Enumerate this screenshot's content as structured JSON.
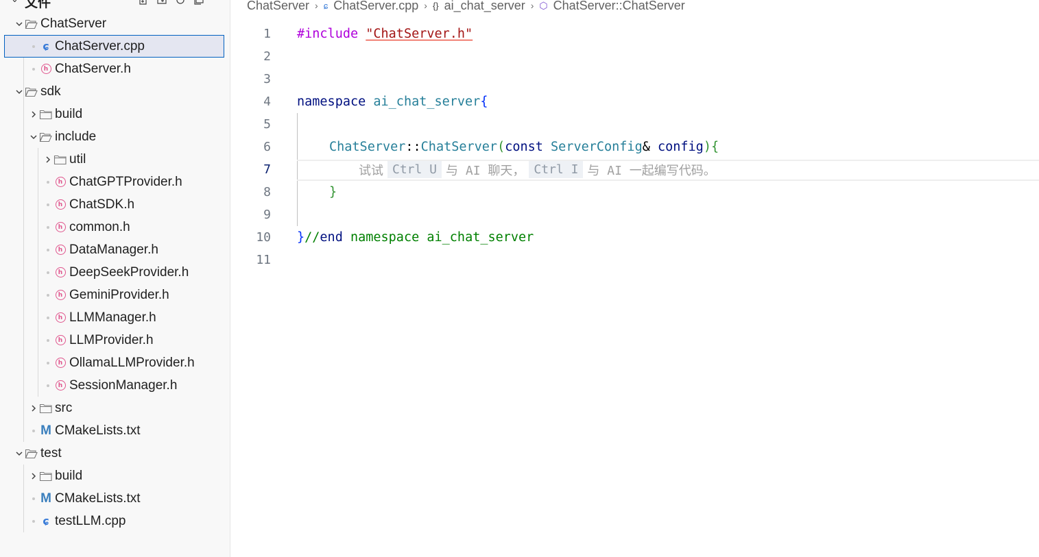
{
  "sidebar": {
    "title": "文件",
    "actions": [
      "new-file-icon",
      "new-folder-icon",
      "refresh-icon",
      "collapse-all-icon"
    ],
    "items": [
      {
        "label": "ChatServer",
        "type": "folder-open",
        "depth": 0
      },
      {
        "label": "ChatServer.cpp",
        "type": "cpp",
        "depth": 1,
        "selected": true
      },
      {
        "label": "ChatServer.h",
        "type": "h",
        "depth": 1
      },
      {
        "label": "sdk",
        "type": "folder-open",
        "depth": 0
      },
      {
        "label": "build",
        "type": "folder-closed",
        "depth": 1
      },
      {
        "label": "include",
        "type": "folder-open",
        "depth": 1
      },
      {
        "label": "util",
        "type": "folder-closed",
        "depth": 2
      },
      {
        "label": "ChatGPTProvider.h",
        "type": "h",
        "depth": 2
      },
      {
        "label": "ChatSDK.h",
        "type": "h",
        "depth": 2
      },
      {
        "label": "common.h",
        "type": "h",
        "depth": 2
      },
      {
        "label": "DataManager.h",
        "type": "h",
        "depth": 2
      },
      {
        "label": "DeepSeekProvider.h",
        "type": "h",
        "depth": 2
      },
      {
        "label": "GeminiProvider.h",
        "type": "h",
        "depth": 2
      },
      {
        "label": "LLMManager.h",
        "type": "h",
        "depth": 2
      },
      {
        "label": "LLMProvider.h",
        "type": "h",
        "depth": 2
      },
      {
        "label": "OllamaLLMProvider.h",
        "type": "h",
        "depth": 2
      },
      {
        "label": "SessionManager.h",
        "type": "h",
        "depth": 2
      },
      {
        "label": "src",
        "type": "folder-closed",
        "depth": 1
      },
      {
        "label": "CMakeLists.txt",
        "type": "cmake",
        "depth": 1
      },
      {
        "label": "test",
        "type": "folder-open",
        "depth": 0
      },
      {
        "label": "build",
        "type": "folder-closed",
        "depth": 1
      },
      {
        "label": "CMakeLists.txt",
        "type": "cmake",
        "depth": 1
      },
      {
        "label": "testLLM.cpp",
        "type": "cpp",
        "depth": 1
      }
    ]
  },
  "breadcrumb": {
    "items": [
      "ChatServer",
      "ChatServer.cpp",
      "ai_chat_server",
      "ChatServer::ChatServer"
    ]
  },
  "editor": {
    "active_line": 7,
    "line_numbers": [
      "1",
      "2",
      "3",
      "4",
      "5",
      "6",
      "7",
      "8",
      "9",
      "10",
      "11"
    ],
    "code": {
      "l1_directive": "#include",
      "l1_string": "\"ChatServer.h\"",
      "l4_keyword": "namespace",
      "l4_name": "ai_chat_server",
      "l4_brace": "{",
      "l6_class": "ChatServer",
      "l6_scope": "::",
      "l6_ctor": "ChatServer",
      "l6_paren_open": "(",
      "l6_const": "const",
      "l6_type": "ServerConfig",
      "l6_amp": "&",
      "l6_param": "config",
      "l6_paren_close": ")",
      "l6_brace": "{",
      "l8_brace": "}",
      "l10_brace": "}",
      "l10_comment_slashes": "//",
      "l10_comment_end": "end",
      "l10_namespace": "namespace",
      "l10_name": "ai_chat_server"
    },
    "inline_hint": {
      "prefix": "试试",
      "key1": "Ctrl U",
      "middle": "与 AI 聊天，",
      "key2": "Ctrl I",
      "suffix": "与 AI 一起编写代码。"
    }
  },
  "colors": {
    "selection_border": "#0060c0",
    "header_icon": "#e0558d",
    "cpp_icon": "#3b7dd8",
    "cmake_icon": "#3a7fbd",
    "keyword": "#0000ff",
    "preprocessor": "#af00db",
    "string": "#a31515",
    "type": "#267f99",
    "comment": "#008000"
  }
}
